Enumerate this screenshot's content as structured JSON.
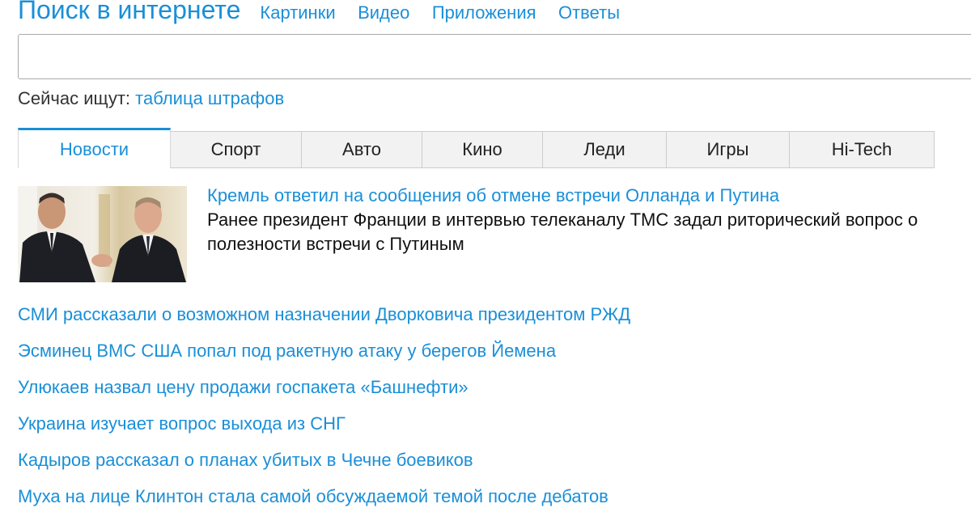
{
  "header": {
    "logo": "Поиск в интернете",
    "nav": [
      "Картинки",
      "Видео",
      "Приложения",
      "Ответы"
    ]
  },
  "search": {
    "value": "",
    "placeholder": ""
  },
  "trending": {
    "label": "Сейчас ищут:",
    "query": "таблица штрафов"
  },
  "tabs": [
    "Новости",
    "Спорт",
    "Авто",
    "Кино",
    "Леди",
    "Игры",
    "Hi-Tech"
  ],
  "active_tab": "Новости",
  "colors": {
    "link": "#1a8fd8",
    "text": "#111111",
    "tab_bg": "#f2f2f2"
  },
  "lead_story": {
    "title": "Кремль ответил на сообщения об отмене встречи Олланда и Путина",
    "summary": "Ранее президент Франции в интервью телеканалу TMC задал риторический вопрос о полезности встречи с Путиным",
    "image_description": "photo-two-men-handshake"
  },
  "headlines": [
    "СМИ рассказали о возможном назначении Дворковича президентом РЖД",
    "Эсминец ВМС США попал под ракетную атаку у берегов Йемена",
    "Улюкаев назвал цену продажи госпакета «Башнефти»",
    "Украина изучает вопрос выхода из СНГ",
    "Кадыров рассказал о планах убитых в Чечне боевиков",
    "Муха на лице Клинтон стала самой обсуждаемой темой после дебатов"
  ]
}
